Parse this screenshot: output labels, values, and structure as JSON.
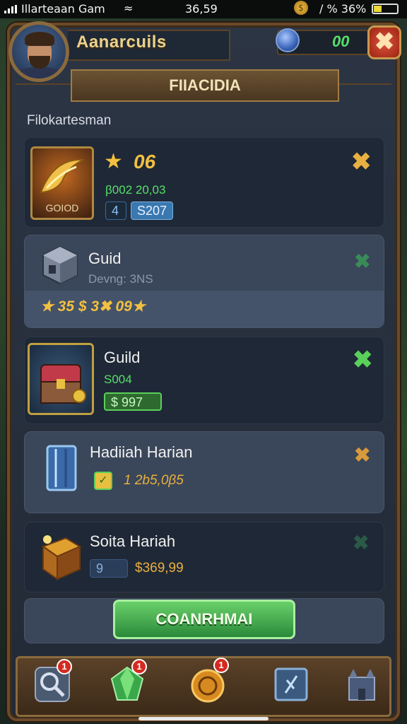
{
  "status_bar": {
    "carrier": "Illarteaan Gam",
    "time": "36,59",
    "right_text": "∕ % 36%"
  },
  "header": {
    "player_name": "Aanarcuils",
    "gem_count": "00",
    "close_glyph": "✖"
  },
  "panel": {
    "title": "FIIACIDIA",
    "section_label": "Filokartesman"
  },
  "items": [
    {
      "icon": "gold-scythe-icon",
      "icon_caption": "GOIOD",
      "star_value": "06",
      "detail": "β002 20,03",
      "badge_num": "4",
      "badge_value": "S207",
      "mark": "✖",
      "mark_color": "#e8b040"
    },
    {
      "icon": "stone-cube-icon",
      "title": "Guid",
      "detail": "Devng: 3NS",
      "rewards": "★ 35 $ 3✖ 09★",
      "mark": "✖",
      "mark_color": "#3a8a5a"
    },
    {
      "icon": "treasure-chest-icon",
      "title": "Guild",
      "detail": "S004",
      "price": "$ 997",
      "mark": "✖",
      "mark_color": "#5ad05a"
    },
    {
      "icon": "crystal-pillar-icon",
      "title": "Hadiiah Harian",
      "detail": "1 2b5,0β5",
      "mark": "✖",
      "mark_color": "#d89a3a"
    },
    {
      "icon": "golden-box-icon",
      "title": "Soita Hariah",
      "badge_num": "9",
      "detail": "$369,99",
      "mark": "✖",
      "mark_color": "#2a5a48"
    }
  ],
  "confirm_button": "COANRHMAI",
  "tabs": [
    {
      "icon": "magnifier-icon",
      "badge": "1"
    },
    {
      "icon": "green-gem-icon",
      "badge": "1"
    },
    {
      "icon": "gold-coin-icon",
      "badge": "1"
    },
    {
      "icon": "rune-tablet-icon",
      "badge": ""
    },
    {
      "icon": "castle-icon",
      "badge": ""
    }
  ],
  "colors": {
    "gold": "#ecd28c",
    "green": "#56e06a",
    "panel": "#222a36",
    "wood": "#6b4a2a",
    "close_red": "#d8412a"
  }
}
